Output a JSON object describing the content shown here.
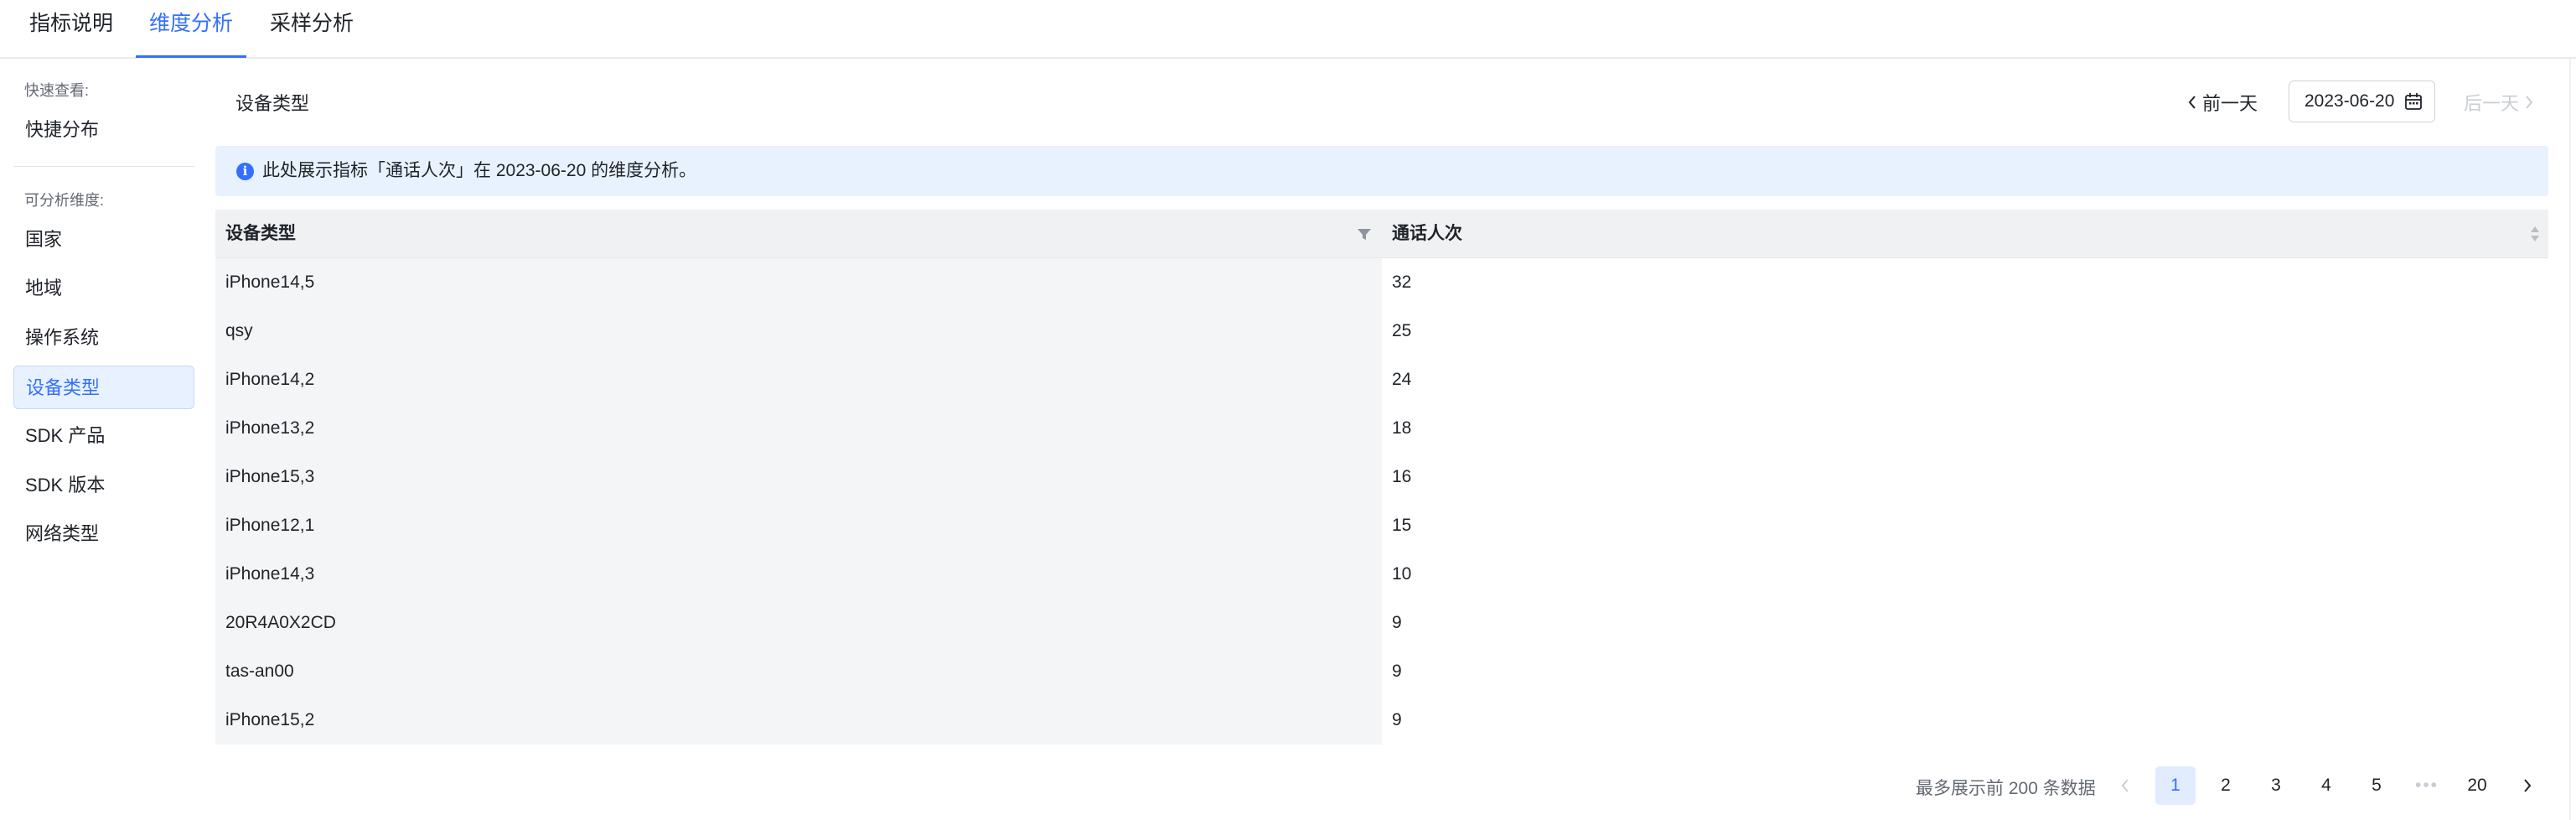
{
  "tabs": [
    "指标说明",
    "维度分析",
    "采样分析"
  ],
  "sidebar": {
    "quick_header": "快速查看:",
    "quick_item": "快捷分布",
    "dims_header": "可分析维度:",
    "dims": [
      "国家",
      "地域",
      "操作系统",
      "设备类型",
      "SDK 产品",
      "SDK 版本",
      "网络类型"
    ],
    "active_index": 3
  },
  "main": {
    "title": "设备类型",
    "prev_day": "前一天",
    "date": "2023-06-20",
    "next_day": "后一天",
    "info": "此处展示指标「通话人次」在 2023-06-20 的维度分析。"
  },
  "table": {
    "columns": [
      "设备类型",
      "通话人次"
    ],
    "rows": [
      [
        "iPhone14,5",
        "32"
      ],
      [
        "qsy",
        "25"
      ],
      [
        "iPhone14,2",
        "24"
      ],
      [
        "iPhone13,2",
        "18"
      ],
      [
        "iPhone15,3",
        "16"
      ],
      [
        "iPhone12,1",
        "15"
      ],
      [
        "iPhone14,3",
        "10"
      ],
      [
        "20R4A0X2CD",
        "9"
      ],
      [
        "tas-an00",
        "9"
      ],
      [
        "iPhone15,2",
        "9"
      ]
    ]
  },
  "pagination": {
    "note": "最多展示前 200 条数据",
    "pages": [
      "1",
      "2",
      "3",
      "4",
      "5"
    ],
    "ellipsis": "•••",
    "last": "20",
    "current": "1"
  },
  "colors": {
    "accent": "#3370ff",
    "info_bg": "#e8f2ff",
    "active_item_bg": "#e8f1ff"
  }
}
